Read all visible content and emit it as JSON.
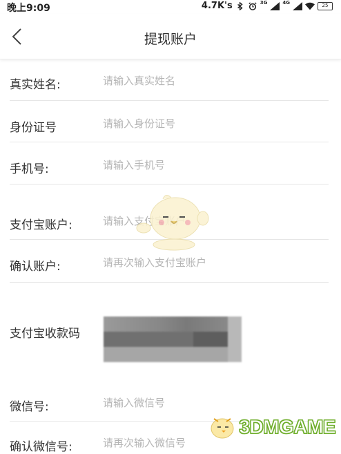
{
  "status_bar": {
    "time": "晚上9:09",
    "net_speed": "4.7K's",
    "net_3g": "3G",
    "net_4g": "4G",
    "battery": "25"
  },
  "header": {
    "title": "提现账户"
  },
  "form": {
    "name": {
      "label": "真实姓名:",
      "placeholder": "请输入真实姓名"
    },
    "id_number": {
      "label": "身份证号",
      "placeholder": "请输入身份证号"
    },
    "phone": {
      "label": "手机号:",
      "placeholder": "请输入手机号"
    },
    "alipay": {
      "label": "支付宝账户:",
      "placeholder": "请输入支付宝账户"
    },
    "alipay_confirm": {
      "label": "确认账户:",
      "placeholder": "请再次输入支付宝账户"
    },
    "alipay_qr": {
      "label": "支付宝收款码"
    },
    "wechat": {
      "label": "微信号:",
      "placeholder": "请输入微信号"
    },
    "wechat_confirm": {
      "label": "确认微信号:",
      "placeholder": "请再次输入微信号"
    }
  },
  "watermark": {
    "text": "3DMGAME"
  },
  "colors": {
    "placeholder": "#b5b5b5",
    "divider": "#e6e6e6",
    "watermark_green": "#6fae2c"
  }
}
